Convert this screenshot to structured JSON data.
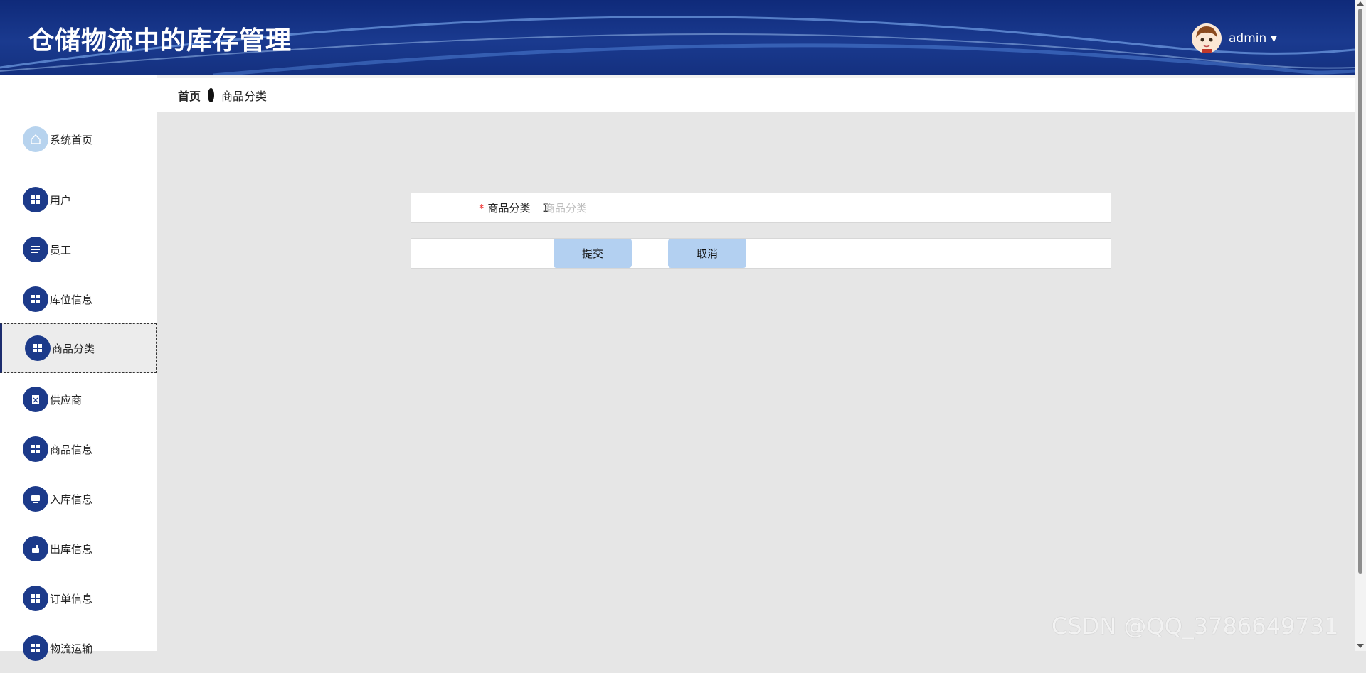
{
  "header": {
    "title": "仓储物流中的库存管理",
    "username": "admin"
  },
  "breadcrumb": {
    "home": "首页",
    "current": "商品分类"
  },
  "sidebar": {
    "items": [
      {
        "label": "系统首页",
        "icon": "home-icon"
      },
      {
        "label": "用户",
        "icon": "grid-icon"
      },
      {
        "label": "员工",
        "icon": "list-icon"
      },
      {
        "label": "库位信息",
        "icon": "grid-icon"
      },
      {
        "label": "商品分类",
        "icon": "grid-icon",
        "active": true
      },
      {
        "label": "供应商",
        "icon": "clipboard-icon"
      },
      {
        "label": "商品信息",
        "icon": "grid-icon"
      },
      {
        "label": "入库信息",
        "icon": "tray-icon"
      },
      {
        "label": "出库信息",
        "icon": "hand-icon"
      },
      {
        "label": "订单信息",
        "icon": "grid-icon"
      },
      {
        "label": "物流运输",
        "icon": "grid-icon"
      }
    ]
  },
  "form": {
    "field_label": "商品分类",
    "field_placeholder": "商品分类",
    "field_value": "",
    "submit_label": "提交",
    "cancel_label": "取消"
  },
  "watermark": "CSDN @QQ_3786649731",
  "colors": {
    "header_bg": "#1a3a8f",
    "icon_bg": "#1c3a8a",
    "button_bg": "#b3d0f1",
    "required": "#e33333"
  }
}
